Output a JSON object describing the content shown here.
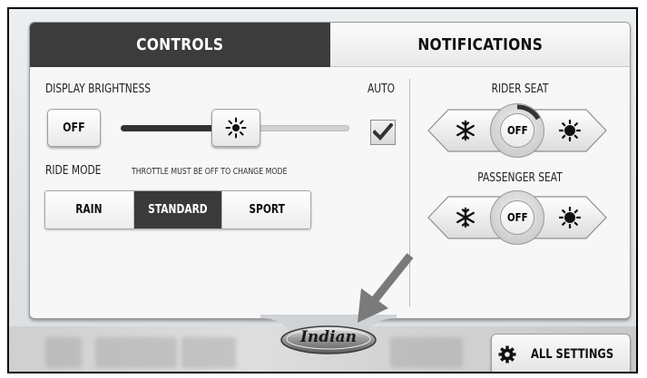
{
  "tabs": [
    {
      "label": "CONTROLS",
      "active": true
    },
    {
      "label": "NOTIFICATIONS",
      "active": false
    }
  ],
  "brightness": {
    "label": "DISPLAY BRIGHTNESS",
    "off_button": "OFF",
    "auto_label": "AUTO",
    "auto_checked": true,
    "level": 0.42,
    "thumb_icon": "sun-icon"
  },
  "ride_mode": {
    "label": "RIDE MODE",
    "note": "THROTTLE MUST BE OFF TO CHANGE MODE",
    "options": [
      "RAIN",
      "STANDARD",
      "SPORT"
    ],
    "selected": "STANDARD"
  },
  "rider_seat": {
    "label": "RIDER SEAT",
    "state": "OFF",
    "cool_icon": "snowflake-icon",
    "heat_icon": "sun-icon"
  },
  "passenger_seat": {
    "label": "PASSENGER SEAT",
    "state": "OFF",
    "cool_icon": "snowflake-icon",
    "heat_icon": "sun-icon"
  },
  "logo": {
    "text": "Indian"
  },
  "all_settings": {
    "label": "ALL SETTINGS",
    "icon": "gear-icon"
  },
  "colors": {
    "active_tab": "#3c3c3c",
    "selected_segment": "#3a3a3a"
  }
}
